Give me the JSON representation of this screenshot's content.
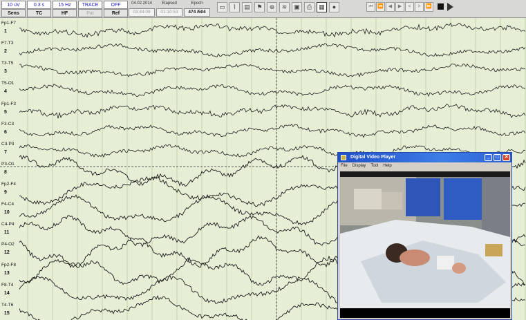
{
  "toolbar": {
    "settings": [
      {
        "value": "10 uV",
        "label": "Sens",
        "label_disabled": false
      },
      {
        "value": "0.3 s",
        "label": "TC",
        "label_disabled": false
      },
      {
        "value": "15 Hz",
        "label": "HF",
        "label_disabled": false
      },
      {
        "value": "TRACE",
        "label": "Pat",
        "label_disabled": true
      },
      {
        "value": "OFF",
        "label": "Ref",
        "label_disabled": false
      }
    ],
    "date": "04.02.2014",
    "time_value": "03:44:09",
    "elapsed_label": "Elapsed",
    "elapsed_value": "01:10:53",
    "epoch_label": "Epoch",
    "epoch_value": "474 /504",
    "view_tools": [
      "waveform-view-icon",
      "montage-icon",
      "spectral-icon",
      "marker-icon",
      "zoom-icon",
      "filter-icon",
      "video-icon",
      "print-icon",
      "grid-icon",
      "record-icon"
    ],
    "nav_buttons": [
      {
        "glyph": "⏮",
        "icon": "first-page-icon"
      },
      {
        "glyph": "⏪",
        "icon": "fast-back-icon"
      },
      {
        "glyph": "◀",
        "icon": "prev-page-icon"
      },
      {
        "glyph": "▶",
        "icon": "next-page-icon"
      },
      {
        "glyph": "<",
        "icon": "step-back-icon"
      },
      {
        "glyph": ">",
        "icon": "step-forward-icon"
      },
      {
        "glyph": "⏩",
        "icon": "fast-forward-icon"
      }
    ]
  },
  "eeg": {
    "background_color": "#e6efd5",
    "grid_color": "#a9bf8e",
    "trace_color": "#1a1a1a",
    "cursor_color": "#333333",
    "channels": [
      {
        "number": "1",
        "label": "Fp1-F7"
      },
      {
        "number": "2",
        "label": "F7-T3"
      },
      {
        "number": "3",
        "label": "T3-T5"
      },
      {
        "number": "4",
        "label": "T5-O1"
      },
      {
        "number": "5",
        "label": "Fp1-F3"
      },
      {
        "number": "6",
        "label": "F3-C3"
      },
      {
        "number": "7",
        "label": "C3-P3"
      },
      {
        "number": "8",
        "label": "P3-O1"
      },
      {
        "number": "9",
        "label": "Fp2-F4"
      },
      {
        "number": "10",
        "label": "F4-C4"
      },
      {
        "number": "11",
        "label": "C4-P4"
      },
      {
        "number": "12",
        "label": "P4-O2"
      },
      {
        "number": "13",
        "label": "Fp2-F8"
      },
      {
        "number": "14",
        "label": "F8-T4"
      },
      {
        "number": "15",
        "label": "T4-T6"
      }
    ]
  },
  "video_player": {
    "title": "Digital Video Player",
    "menu": [
      "File",
      "Display",
      "Tool",
      "Help"
    ],
    "buttons": [
      {
        "glyph": "_",
        "icon": "minimize-icon"
      },
      {
        "glyph": "□",
        "icon": "maximize-icon"
      },
      {
        "glyph": "✕",
        "icon": "close-icon"
      }
    ]
  }
}
